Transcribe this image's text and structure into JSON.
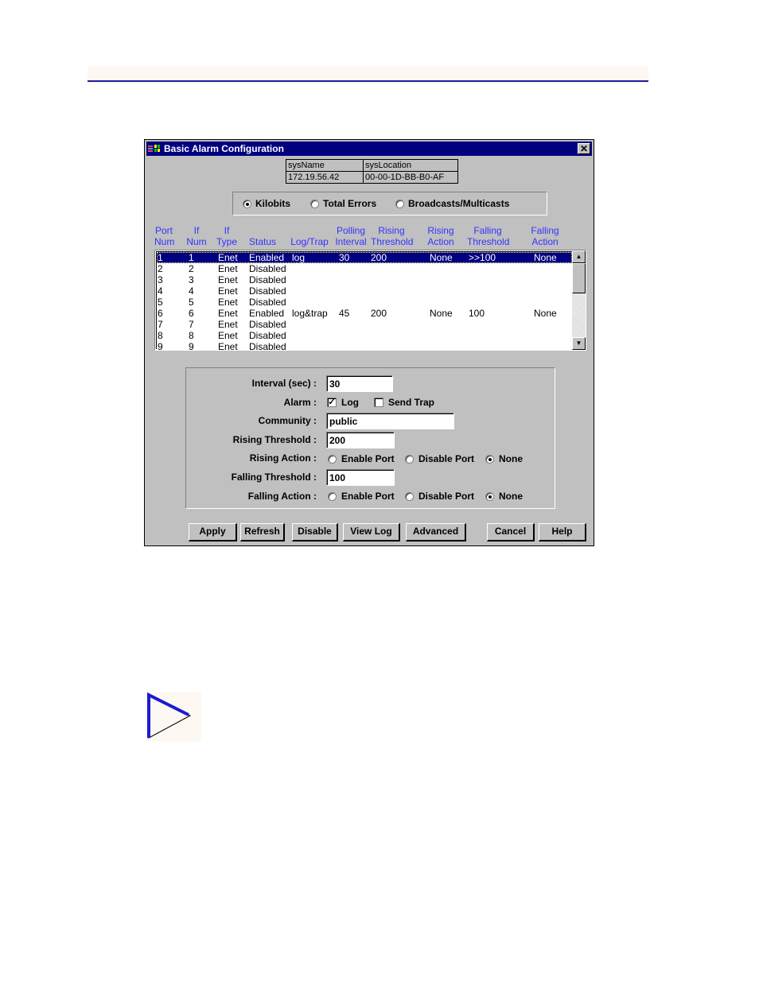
{
  "window": {
    "title": "Basic Alarm Configuration",
    "close_label": "✕"
  },
  "sysinfo": {
    "headers": [
      "sysName",
      "sysLocation"
    ],
    "values": [
      "172.19.56.42",
      "00-00-1D-BB-B0-AF"
    ]
  },
  "mode": {
    "options": [
      "Kilobits",
      "Total Errors",
      "Broadcasts/Multicasts"
    ],
    "selected": "Kilobits"
  },
  "table": {
    "headers": [
      [
        "Port",
        "Num"
      ],
      [
        "If",
        "Num"
      ],
      [
        "If",
        "Type"
      ],
      [
        "",
        "Status"
      ],
      [
        "",
        "Log/Trap"
      ],
      [
        "Polling",
        "Interval"
      ],
      [
        "Rising",
        "Threshold"
      ],
      [
        "Rising",
        "Action"
      ],
      [
        "Falling",
        "Threshold"
      ],
      [
        "Falling",
        "Action"
      ]
    ],
    "rows": [
      {
        "port": "1",
        "ifnum": "1",
        "type": "Enet",
        "status": "Enabled",
        "logtrap": "log",
        "interval": "30",
        "rise": "200",
        "riseact": "None",
        "fall": ">>100",
        "fallact": "None",
        "selected": true
      },
      {
        "port": "2",
        "ifnum": "2",
        "type": "Enet",
        "status": "Disabled",
        "logtrap": "",
        "interval": "",
        "rise": "",
        "riseact": "",
        "fall": "",
        "fallact": ""
      },
      {
        "port": "3",
        "ifnum": "3",
        "type": "Enet",
        "status": "Disabled",
        "logtrap": "",
        "interval": "",
        "rise": "",
        "riseact": "",
        "fall": "",
        "fallact": ""
      },
      {
        "port": "4",
        "ifnum": "4",
        "type": "Enet",
        "status": "Disabled",
        "logtrap": "",
        "interval": "",
        "rise": "",
        "riseact": "",
        "fall": "",
        "fallact": ""
      },
      {
        "port": "5",
        "ifnum": "5",
        "type": "Enet",
        "status": "Disabled",
        "logtrap": "",
        "interval": "",
        "rise": "",
        "riseact": "",
        "fall": "",
        "fallact": ""
      },
      {
        "port": "6",
        "ifnum": "6",
        "type": "Enet",
        "status": "Enabled",
        "logtrap": "log&trap",
        "interval": "45",
        "rise": "200",
        "riseact": "None",
        "fall": "100",
        "fallact": "None"
      },
      {
        "port": "7",
        "ifnum": "7",
        "type": "Enet",
        "status": "Disabled",
        "logtrap": "",
        "interval": "",
        "rise": "",
        "riseact": "",
        "fall": "",
        "fallact": ""
      },
      {
        "port": "8",
        "ifnum": "8",
        "type": "Enet",
        "status": "Disabled",
        "logtrap": "",
        "interval": "",
        "rise": "",
        "riseact": "",
        "fall": "",
        "fallact": ""
      },
      {
        "port": "9",
        "ifnum": "9",
        "type": "Enet",
        "status": "Disabled",
        "logtrap": "",
        "interval": "",
        "rise": "",
        "riseact": "",
        "fall": "",
        "fallact": ""
      }
    ]
  },
  "form": {
    "interval_label": "Interval (sec) :",
    "interval_value": "30",
    "alarm_label": "Alarm :",
    "log_label": "Log",
    "log_checked": true,
    "send_trap_label": "Send Trap",
    "send_trap_checked": false,
    "community_label": "Community :",
    "community_value": "public",
    "rising_threshold_label": "Rising Threshold :",
    "rising_threshold_value": "200",
    "rising_action_label": "Rising Action :",
    "falling_threshold_label": "Falling Threshold :",
    "falling_threshold_value": "100",
    "falling_action_label": "Falling Action :",
    "action_options": [
      "Enable Port",
      "Disable Port",
      "None"
    ],
    "rising_action_selected": "None",
    "falling_action_selected": "None"
  },
  "buttons": {
    "apply": "Apply",
    "refresh": "Refresh",
    "disable": "Disable",
    "view_log": "View Log",
    "advanced": "Advanced",
    "cancel": "Cancel",
    "help": "Help"
  },
  "colors": {
    "title_bar": "#000080",
    "header_text": "#3333ff",
    "page_rule": "#1a1aa6",
    "dialog_bg": "#c0c0c0"
  }
}
